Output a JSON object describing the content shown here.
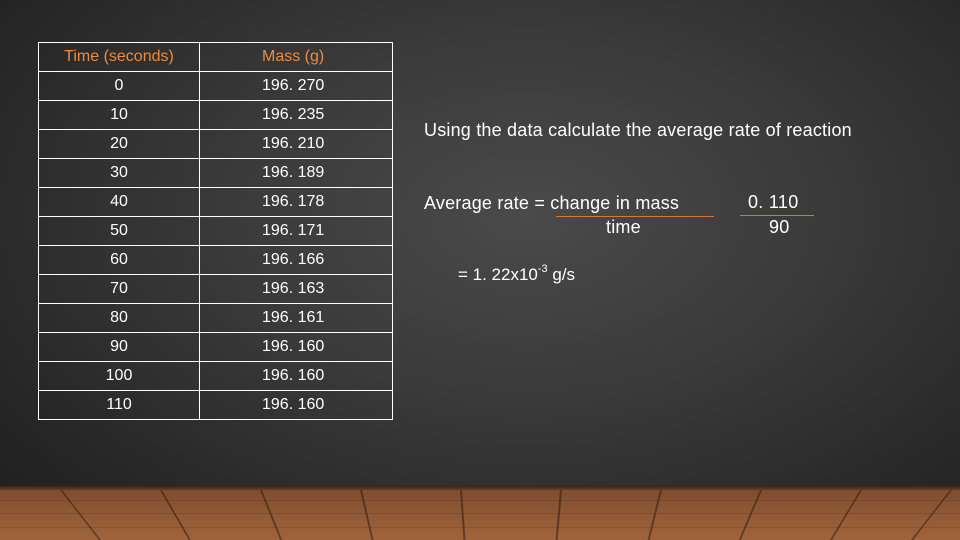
{
  "table": {
    "headers": [
      "Time (seconds)",
      "Mass (g)"
    ],
    "rows": [
      {
        "time": "0",
        "mass": "196. 270"
      },
      {
        "time": "10",
        "mass": "196. 235"
      },
      {
        "time": "20",
        "mass": "196. 210"
      },
      {
        "time": "30",
        "mass": "196. 189"
      },
      {
        "time": "40",
        "mass": "196. 178"
      },
      {
        "time": "50",
        "mass": "196. 171"
      },
      {
        "time": "60",
        "mass": "196. 166"
      },
      {
        "time": "70",
        "mass": "196. 163"
      },
      {
        "time": "80",
        "mass": "196. 161"
      },
      {
        "time": "90",
        "mass": "196. 160"
      },
      {
        "time": "100",
        "mass": "196. 160"
      },
      {
        "time": "110",
        "mass": "196. 160"
      }
    ]
  },
  "prompt": "Using the data calculate the average rate of reaction",
  "formula": {
    "label": "Average rate = change in mass",
    "denominator": "time"
  },
  "fraction": {
    "numerator": "0. 110",
    "denominator": "90"
  },
  "result": {
    "prefix": "= 1. 22x10",
    "exponent": "-3",
    "unit": " g/s"
  },
  "colors": {
    "header_text": "#f08a3c",
    "fraction_line": "#d9772f",
    "background": "#3a3a3a"
  }
}
